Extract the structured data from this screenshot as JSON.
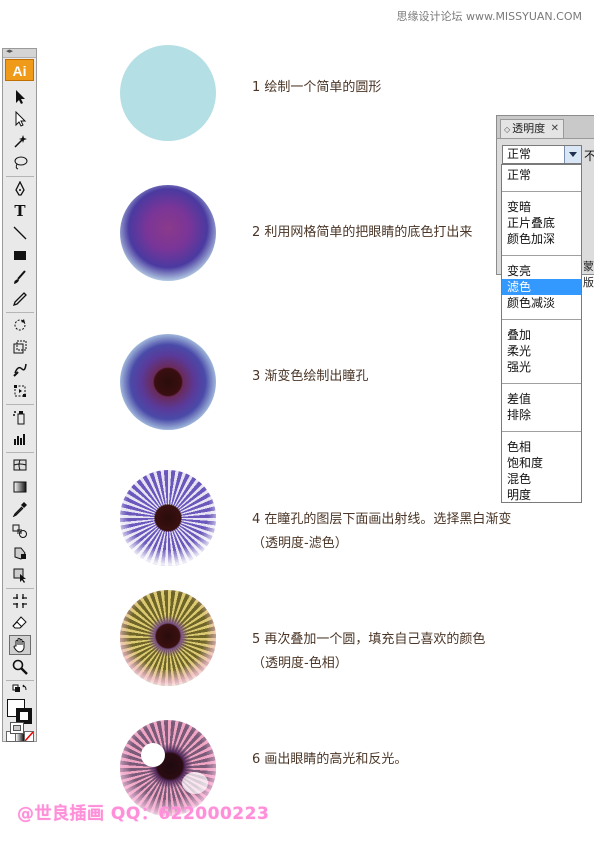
{
  "watermark_top": "思缘设计论坛 www.MISSYUAN.COM",
  "watermark_bottom": "@世良插画 QQ：622000223",
  "toolbar": {
    "logo": "Ai",
    "tools": [
      "selection-icon",
      "direct-selection-icon",
      "magic-wand-icon",
      "lasso-icon",
      "pen-icon",
      "type-icon",
      "line-segment-icon",
      "rectangle-icon",
      "paintbrush-icon",
      "pencil-icon",
      "rotate-icon",
      "scale-icon",
      "warp-icon",
      "free-transform-icon",
      "symbol-sprayer-icon",
      "column-graph-icon",
      "mesh-icon",
      "gradient-icon",
      "eyedropper-icon",
      "blend-icon",
      "live-paint-icon",
      "slice-icon",
      "eraser-icon",
      "hand-icon",
      "zoom-icon"
    ]
  },
  "steps": [
    "1 绘制一个简单的圆形",
    "2 利用网格简单的把眼睛的底色打出来",
    "3 渐变色绘制出瞳孔",
    "4 在瞳孔的图层下面画出射线。选择黑白渐变",
    "（透明度-滤色）",
    "5 再次叠加一个圆，填充自己喜欢的颜色",
    "（透明度-色相）",
    "6 画出眼睛的高光和反光。"
  ],
  "transparency_panel": {
    "tab_label": "透明度",
    "blend_mode_value": "正常",
    "opacity_label_fragment": "不",
    "side_fragment": "蒙版",
    "options": [
      "正常",
      "变暗",
      "正片叠底",
      "颜色加深",
      "变亮",
      "滤色",
      "颜色减淡",
      "叠加",
      "柔光",
      "强光",
      "差值",
      "排除",
      "色相",
      "饱和度",
      "混色",
      "明度"
    ],
    "highlighted": "滤色"
  },
  "colors": {
    "step_text": "#4a3526",
    "circle1": "#b4dfe4",
    "highlight": "#3399ff",
    "ai_orange": "#f09a19",
    "watermark_pink": "#ff8fd8"
  }
}
